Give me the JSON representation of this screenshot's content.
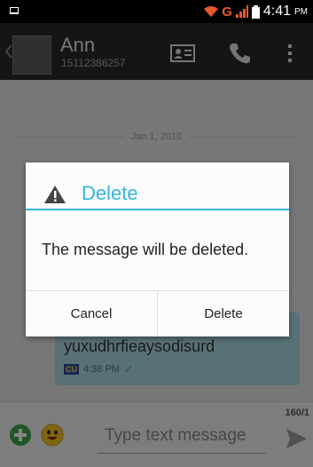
{
  "status_bar": {
    "network": "G",
    "time": "4:41",
    "ampm": "PM"
  },
  "header": {
    "contact_name": "Ann",
    "contact_number": "15112386257"
  },
  "conversation": {
    "date": "Jan 1, 2010",
    "message": {
      "text": "yuxudhrfieaysodisurd",
      "carrier": "CU",
      "time": "4:38 PM"
    }
  },
  "compose": {
    "counter": "160/1",
    "placeholder": "Type text message"
  },
  "dialog": {
    "title": "Delete",
    "message": "The message will be deleted.",
    "cancel_label": "Cancel",
    "delete_label": "Delete"
  },
  "colors": {
    "accent": "#35b4e0",
    "action_bar": "#2a2a2a",
    "bubble": "#a9d9e3"
  }
}
